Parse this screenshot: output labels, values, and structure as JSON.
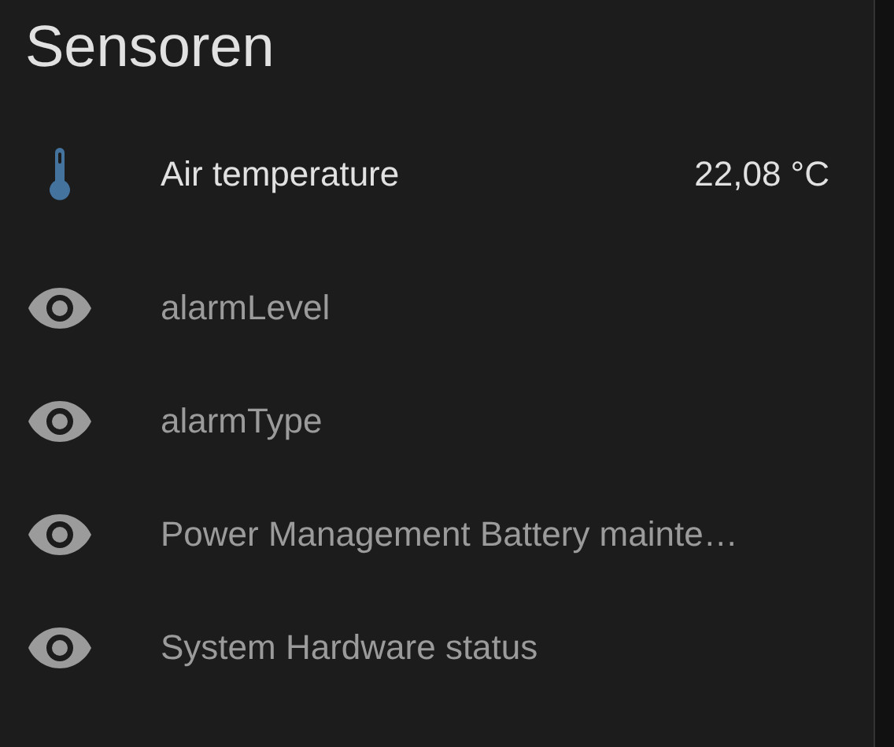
{
  "card": {
    "title": "Sensoren",
    "entities": [
      {
        "kind": "temperature",
        "name": "Air temperature",
        "state": "22,08 °C",
        "unavailable": false
      },
      {
        "kind": "generic",
        "name": "alarmLevel",
        "unavailable": true
      },
      {
        "kind": "generic",
        "name": "alarmType",
        "unavailable": true
      },
      {
        "kind": "generic",
        "name": "Power Management Battery mainte…",
        "unavailable": true
      },
      {
        "kind": "generic",
        "name": "System Hardware status",
        "unavailable": true
      }
    ]
  }
}
